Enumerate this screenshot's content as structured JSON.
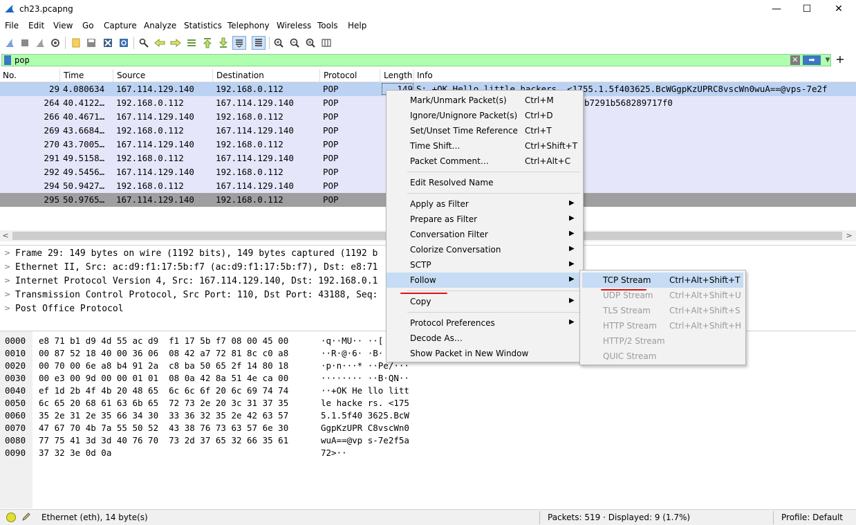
{
  "window": {
    "title": "ch23.pcapng",
    "minimize": "—",
    "maximize": "☐",
    "close": "✕"
  },
  "menu": [
    "File",
    "Edit",
    "View",
    "Go",
    "Capture",
    "Analyze",
    "Statistics",
    "Telephony",
    "Wireless",
    "Tools",
    "Help"
  ],
  "filter": {
    "value": "pop",
    "clear": "✕",
    "apply": "➡",
    "dropdown": "▼",
    "add": "+"
  },
  "columns": [
    "No.",
    "Time",
    "Source",
    "Destination",
    "Protocol",
    "Length",
    "Info"
  ],
  "packets": [
    {
      "no": "29",
      "time": "4.080634",
      "src": "167.114.129.140",
      "dst": "192.168.0.112",
      "proto": "POP",
      "len": "149",
      "info": "S: +OK Hello little hackers. <1755.1.5f403625.BcWGgpKzUPRC8vscWn0wuA==@vps-7e2f"
    },
    {
      "no": "264",
      "time": "40.4122…",
      "src": "192.168.0.112",
      "dst": "167.114.129.140",
      "proto": "POP",
      "len": "",
      "info": "b7291b568289717f0"
    },
    {
      "no": "266",
      "time": "40.4671…",
      "src": "167.114.129.140",
      "dst": "192.168.0.112",
      "proto": "POP",
      "len": "",
      "info": ""
    },
    {
      "no": "269",
      "time": "43.6684…",
      "src": "192.168.0.112",
      "dst": "167.114.129.140",
      "proto": "POP",
      "len": "",
      "info": ""
    },
    {
      "no": "270",
      "time": "43.7005…",
      "src": "167.114.129.140",
      "dst": "192.168.0.112",
      "proto": "POP",
      "len": "",
      "info": ""
    },
    {
      "no": "291",
      "time": "49.5158…",
      "src": "192.168.0.112",
      "dst": "167.114.129.140",
      "proto": "POP",
      "len": "",
      "info": ""
    },
    {
      "no": "292",
      "time": "49.5456…",
      "src": "167.114.129.140",
      "dst": "192.168.0.112",
      "proto": "POP",
      "len": "",
      "info": ""
    },
    {
      "no": "294",
      "time": "50.9427…",
      "src": "192.168.0.112",
      "dst": "167.114.129.140",
      "proto": "POP",
      "len": "",
      "info": ""
    },
    {
      "no": "295",
      "time": "50.9765…",
      "src": "167.114.129.140",
      "dst": "192.168.0.112",
      "proto": "POP",
      "len": "",
      "info": ""
    }
  ],
  "details": [
    "Frame 29: 149 bytes on wire (1192 bits), 149 bytes captured (1192 b",
    "Ethernet II, Src: ac:d9:f1:17:5b:f7 (ac:d9:f1:17:5b:f7), Dst: e8:71",
    "Internet Protocol Version 4, Src: 167.114.129.140, Dst: 192.168.0.1",
    "Transmission Control Protocol, Src Port: 110, Dst Port: 43188, Seq:",
    "Post Office Protocol"
  ],
  "hex": [
    {
      "off": "0000",
      "bytes": "e8 71 b1 d9 4d 55 ac d9  f1 17 5b f7 08 00 45 00",
      "ascii": "·q··MU·· ··["
    },
    {
      "off": "0010",
      "bytes": "00 87 52 18 40 00 36 06  08 42 a7 72 81 8c c0 a8",
      "ascii": "··R·@·6· ·B·"
    },
    {
      "off": "0020",
      "bytes": "00 70 00 6e a8 b4 91 2a  c8 ba 50 65 2f 14 80 18",
      "ascii": "·p·n···* ··Pe/···"
    },
    {
      "off": "0030",
      "bytes": "00 e3 00 9d 00 00 01 01  08 0a 42 8a 51 4e ca 00",
      "ascii": "········ ··B·QN··"
    },
    {
      "off": "0040",
      "bytes": "ef 1d 2b 4f 4b 20 48 65  6c 6c 6f 20 6c 69 74 74",
      "ascii": "··+OK He llo litt"
    },
    {
      "off": "0050",
      "bytes": "6c 65 20 68 61 63 6b 65  72 73 2e 20 3c 31 37 35",
      "ascii": "le hacke rs. <175"
    },
    {
      "off": "0060",
      "bytes": "35 2e 31 2e 35 66 34 30  33 36 32 35 2e 42 63 57",
      "ascii": "5.1.5f40 3625.BcW"
    },
    {
      "off": "0070",
      "bytes": "47 67 70 4b 7a 55 50 52  43 38 76 73 63 57 6e 30",
      "ascii": "GgpKzUPR C8vscWn0"
    },
    {
      "off": "0080",
      "bytes": "77 75 41 3d 3d 40 76 70  73 2d 37 65 32 66 35 61",
      "ascii": "wuA==@vp s-7e2f5a"
    },
    {
      "off": "0090",
      "bytes": "37 32 3e 0d 0a",
      "ascii": "72>··"
    }
  ],
  "context_menu": [
    {
      "label": "Mark/Unmark Packet(s)",
      "shortcut": "Ctrl+M"
    },
    {
      "label": "Ignore/Unignore Packet(s)",
      "shortcut": "Ctrl+D"
    },
    {
      "label": "Set/Unset Time Reference",
      "shortcut": "Ctrl+T"
    },
    {
      "label": "Time Shift…",
      "shortcut": "Ctrl+Shift+T"
    },
    {
      "label": "Packet Comment…",
      "shortcut": "Ctrl+Alt+C"
    },
    {
      "label": "Edit Resolved Name",
      "shortcut": ""
    },
    {
      "label": "Apply as Filter",
      "shortcut": ""
    },
    {
      "label": "Prepare as Filter",
      "shortcut": ""
    },
    {
      "label": "Conversation Filter",
      "shortcut": ""
    },
    {
      "label": "Colorize Conversation",
      "shortcut": ""
    },
    {
      "label": "SCTP",
      "shortcut": ""
    },
    {
      "label": "Follow",
      "shortcut": ""
    },
    {
      "label": "Copy",
      "shortcut": ""
    },
    {
      "label": "Protocol Preferences",
      "shortcut": ""
    },
    {
      "label": "Decode As…",
      "shortcut": ""
    },
    {
      "label": "Show Packet in New Window",
      "shortcut": ""
    }
  ],
  "submenu_arrow": "▶",
  "follow_submenu": [
    {
      "label": "TCP Stream",
      "shortcut": "Ctrl+Alt+Shift+T"
    },
    {
      "label": "UDP Stream",
      "shortcut": "Ctrl+Alt+Shift+U"
    },
    {
      "label": "TLS Stream",
      "shortcut": "Ctrl+Alt+Shift+S"
    },
    {
      "label": "HTTP Stream",
      "shortcut": "Ctrl+Alt+Shift+H"
    },
    {
      "label": "HTTP/2 Stream",
      "shortcut": ""
    },
    {
      "label": "QUIC Stream",
      "shortcut": ""
    }
  ],
  "status": {
    "left": "Ethernet (eth), 14 byte(s)",
    "middle": "Packets: 519 · Displayed: 9 (1.7%)",
    "right": "Profile: Default"
  },
  "colors": {
    "filter_ok": "#afffaf",
    "row_pop": "#e6e6fa",
    "row_selected": "#bcd2f2",
    "menu_highlight": "#c6dcf4",
    "annotation_red": "#e01010"
  }
}
